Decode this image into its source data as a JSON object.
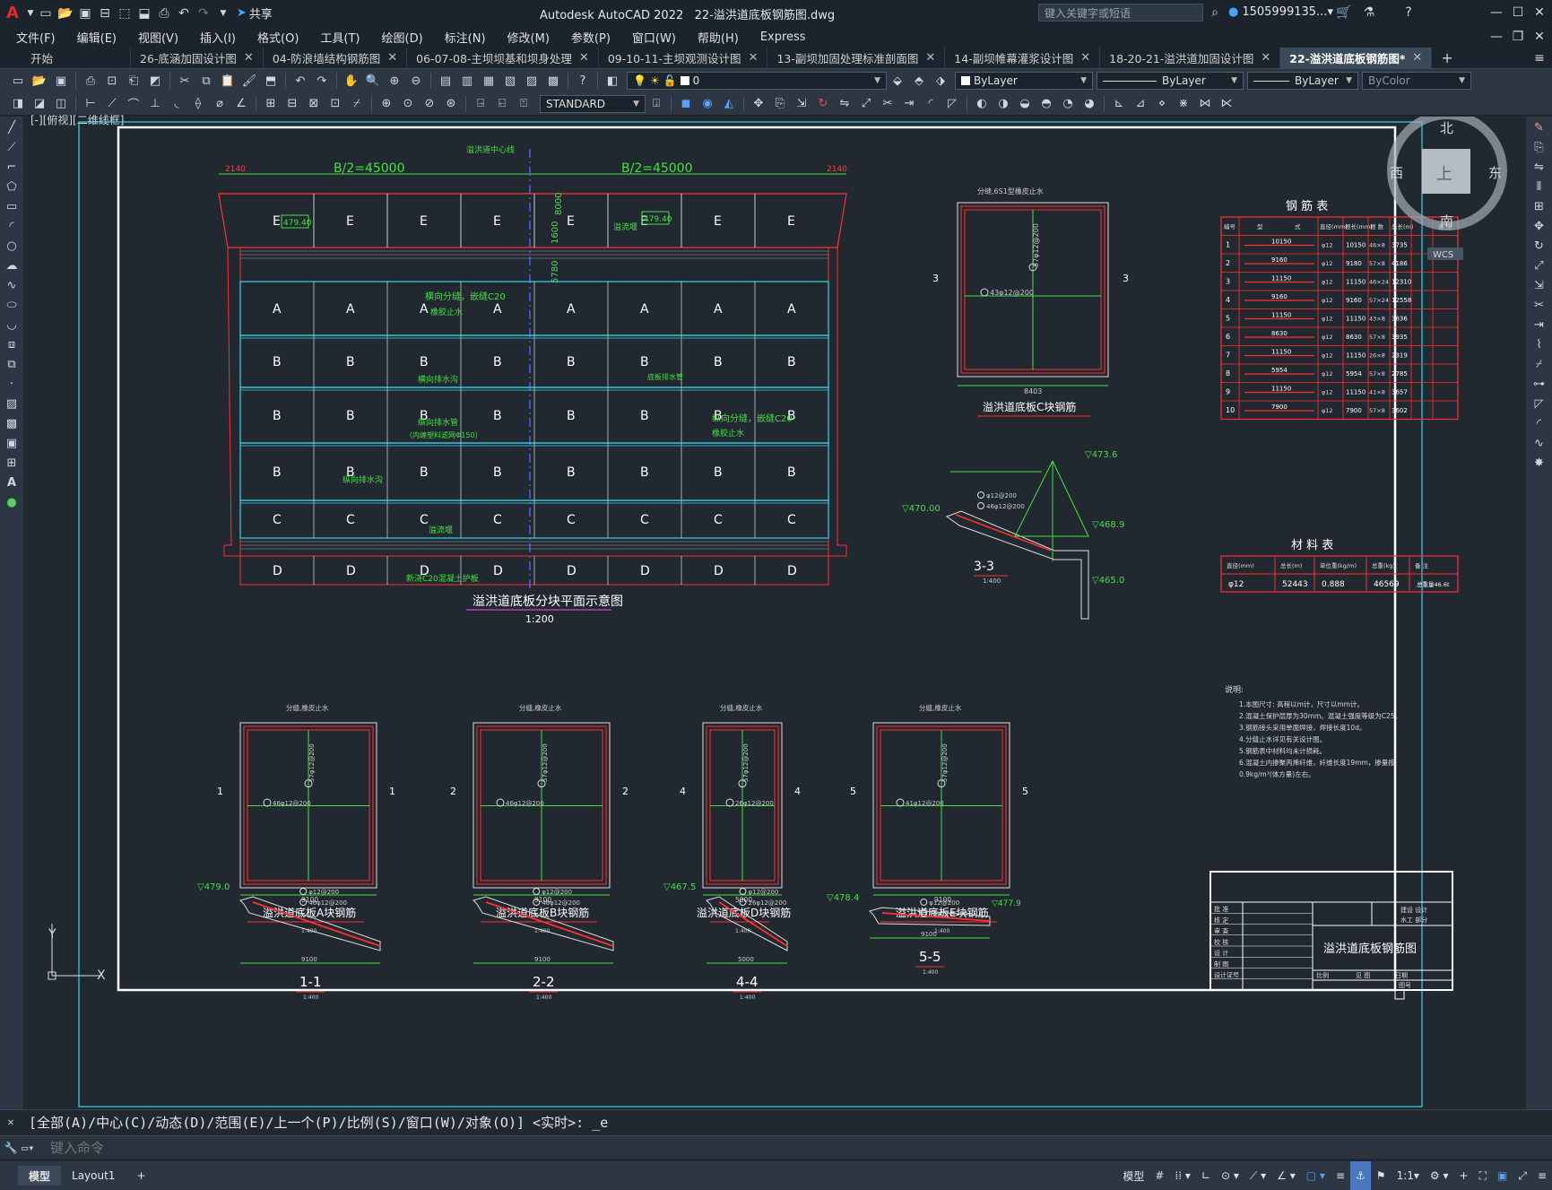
{
  "app": {
    "title": "Autodesk AutoCAD 2022",
    "filename": "22-溢洪道底板钢筋图.dwg",
    "share": "共享",
    "search_placeholder": "键入关键字或短语",
    "user": "1505999135..."
  },
  "menu": [
    "文件(F)",
    "编辑(E)",
    "视图(V)",
    "插入(I)",
    "格式(O)",
    "工具(T)",
    "绘图(D)",
    "标注(N)",
    "修改(M)",
    "参数(P)",
    "窗口(W)",
    "帮助(H)",
    "Express"
  ],
  "tabs": [
    {
      "label": "开始"
    },
    {
      "label": "26-底涵加固设计图"
    },
    {
      "label": "04-防浪墙结构钢筋图"
    },
    {
      "label": "06-07-08-主坝坝基和坝身处理"
    },
    {
      "label": "09-10-11-主坝观测设计图"
    },
    {
      "label": "13-副坝加固处理标准剖面图"
    },
    {
      "label": "14-副坝帷幕灌浆设计图"
    },
    {
      "label": "18-20-21-溢洪道加固设计图"
    },
    {
      "label": "22-溢洪道底板钢筋图*"
    }
  ],
  "toolbar": {
    "layer": "0",
    "color": "ByLayer",
    "linetype": "ByLayer",
    "lineweight": "ByLayer",
    "plotstyle": "ByColor",
    "textstyle": "STANDARD"
  },
  "viewport_label": "[-][俯视][二维线框]",
  "viewcube": {
    "north": "北",
    "south": "南",
    "east": "东",
    "west": "西",
    "top": "上",
    "wcs": "WCS"
  },
  "drawing": {
    "plan_title": "溢洪道底板分块平面示意图",
    "plan_scale": "1:200",
    "dim_left": "B/2=45000",
    "dim_right": "B/2=45000",
    "dim_edge_left": "2140",
    "dim_edge_right": "2140",
    "centerline": "溢洪道中心线",
    "rows": [
      {
        "letter": "E",
        "cols": 8
      },
      {
        "letter": "A",
        "cols": 8
      },
      {
        "letter": "B",
        "cols": 8
      },
      {
        "letter": "B",
        "cols": 8
      },
      {
        "letter": "B",
        "cols": 8
      },
      {
        "letter": "C",
        "cols": 8
      },
      {
        "letter": "D",
        "cols": 8
      }
    ],
    "elev_479": "479.40",
    "elev_479b": "479.40",
    "notes_plan": [
      "横向分缝，嵌缝C20",
      "橡胶止水",
      "纵向排水管",
      "（内缠塑料滤网Φ150）",
      "纵向分缝，嵌缝C20",
      "橡胶止水",
      "溢流堰",
      "底板排水管",
      "新浇C20混凝土护板",
      "纵向排水沟",
      "横向排水沟"
    ],
    "dim_vert": [
      "1600",
      "8000",
      "5780"
    ],
    "c_section_title": "溢洪道底板C块钢筋",
    "c_section_note": "分缝,6S1型橡皮止水",
    "c_bar1": "57φ12@200",
    "c_bar2": "43φ12@200",
    "c_dim": "8403",
    "s33_title": "3-3",
    "s33_scale": "1:400",
    "s33_elev1": "▽473.6",
    "s33_elev2": "▽470.00",
    "s33_elev3": "▽468.9",
    "s33_elev4": "▽465.0",
    "rebar_table_title": "钢 筋 表",
    "rebar_headers": [
      "编号",
      "型",
      "式",
      "直径(mm)",
      "根长(mm)",
      "根 数",
      "总长(m)",
      "备 注"
    ],
    "rebar_rows": [
      [
        "1",
        "10150",
        "φ12",
        "10150",
        "46×8",
        "3735"
      ],
      [
        "2",
        "9160",
        "φ12",
        "9180",
        "57×8",
        "4186"
      ],
      [
        "3",
        "11150",
        "φ12",
        "11150",
        "46×24",
        "12310"
      ],
      [
        "4",
        "9160",
        "φ12",
        "9160",
        "57×24",
        "12558"
      ],
      [
        "5",
        "11150",
        "φ12",
        "11150",
        "43×8",
        "3836"
      ],
      [
        "6",
        "8630",
        "φ12",
        "8630",
        "57×8",
        "3935"
      ],
      [
        "7",
        "11150",
        "φ12",
        "11150",
        "26×8",
        "2319"
      ],
      [
        "8",
        "5954",
        "φ12",
        "5954",
        "57×8",
        "2785"
      ],
      [
        "9",
        "11150",
        "φ12",
        "11150",
        "41×8",
        "3657"
      ],
      [
        "10",
        "7900",
        "φ12",
        "7900",
        "57×8",
        "3602"
      ]
    ],
    "material_title": "材 料 表",
    "material_headers": [
      "直径(mm)",
      "总长(m)",
      "单位重(kg/m)",
      "总重(kg)",
      "备 注"
    ],
    "material_row": [
      "φ12",
      "52443",
      "0.888",
      "46569",
      "总重量46.6t"
    ],
    "notes_title": "说明:",
    "notes": [
      "1.本图尺寸: 高程以m计，尺寸以mm计。",
      "2.混凝土保护层厚为30mm。混凝土强度等级为C25。",
      "3.钢筋接头采用单面焊接，焊接长度10d。",
      "4.分缝止水详见有关设计图。",
      "5.钢筋表中材料均未计损耗。",
      "6.混凝土内掺聚丙烯纤维，纤维长度19mm，掺量按",
      "  0.9kg/m³(体方量)左右。"
    ],
    "sec_a_title": "溢洪道底板A块钢筋",
    "sec_b_title": "溢洪道底板B块钢筋",
    "sec_d_title": "溢洪道底板D块钢筋",
    "sec_e_title": "溢洪道底板E块钢筋",
    "small_scale": "1:400",
    "cut_note": "分缝,橡皮止水",
    "a_bar1": "57φ12@200",
    "a_bar2": "46φ12@200",
    "b_bar2": "46φ12@200",
    "d_bar2": "26φ12@200",
    "e_bar2": "41φ12@200",
    "dim_a": "9100",
    "dim_b": "9100",
    "dim_d": "5000",
    "dim_e": "9100",
    "sec11": "1-1",
    "sec22": "2-2",
    "sec44": "4-4",
    "sec55": "5-5",
    "elev_11": "▽479.0",
    "elev_44": "▽467.5",
    "elev_55a": "▽478.4",
    "elev_55b": "▽477.9",
    "sec_bar1": "φ12@200",
    "sec_bar2": "46φ12@200",
    "sec_bar_d": "26φ12@200",
    "titleblock_name": "溢洪道底板钢筋图",
    "tb_left": [
      "批 准",
      "核 定",
      "审 查",
      "校 核",
      "设 计",
      "制 图",
      "设计证号"
    ],
    "tb_right_a": "建设 设计",
    "tb_right_b": "水工 部分",
    "tb_bottom": [
      "比例",
      "见 图",
      "日期"
    ],
    "tb_bottom2": [
      "图号"
    ]
  },
  "command": {
    "history": "[全部(A)/中心(C)/动态(D)/范围(E)/上一个(P)/比例(S)/窗口(W)/对象(O)] <实时>: _e",
    "placeholder": "键入命令"
  },
  "status": {
    "model_tab": "模型",
    "layout_tab": "Layout1",
    "model_label": "模型",
    "scale": "1:1"
  }
}
